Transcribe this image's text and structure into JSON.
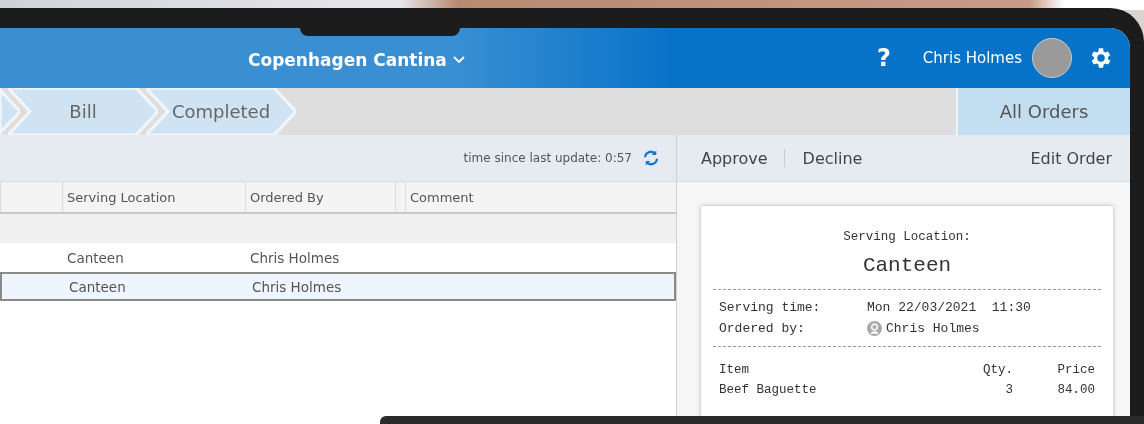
{
  "header": {
    "title": "Copenhagen Cantina",
    "help": "?",
    "user": "Chris Holmes"
  },
  "steps": [
    {
      "label": "Bill"
    },
    {
      "label": "Completed"
    }
  ],
  "all_orders": "All Orders",
  "toolbar": {
    "update_label": "time since last update: 0:57"
  },
  "table": {
    "columns": [
      "Serving Location",
      "Ordered By",
      "Comment"
    ],
    "rows": [
      {
        "serving_location": "Canteen",
        "ordered_by": "Chris Holmes",
        "selected": false
      },
      {
        "serving_location": "Canteen",
        "ordered_by": "Chris Holmes",
        "selected": true
      }
    ]
  },
  "actions": [
    "Approve",
    "Decline"
  ],
  "edit_action": "Edit Order",
  "receipt": {
    "location_label": "Serving Location:",
    "location": "Canteen",
    "fields": [
      {
        "label": "Serving time:",
        "value": "Mon 22/03/2021  11:30",
        "kind": "text"
      },
      {
        "label": "Ordered by:",
        "value": "Chris Holmes",
        "kind": "person"
      }
    ],
    "columns": [
      "Item",
      "Qty.",
      "Price"
    ],
    "items": [
      {
        "name": "Beef Baguette",
        "qty": "3",
        "price": "84.00"
      }
    ]
  }
}
